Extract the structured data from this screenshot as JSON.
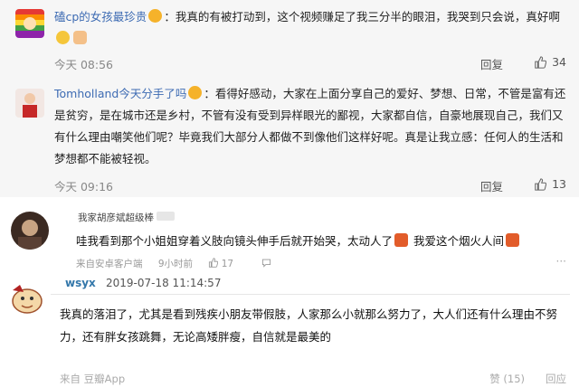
{
  "comments": [
    {
      "user": "磕cp的女孩最珍贵",
      "text": "：我真的有被打动到，这个视频赚足了我三分半的眼泪，我哭到只会说，真好啊",
      "time": "今天 08:56",
      "reply": "回复",
      "likes": "34"
    },
    {
      "user": "Tomholland今天分手了吗",
      "text": "：看得好感动，大家在上面分享自己的爱好、梦想、日常，不管是富有还是贫穷，是在城市还是乡村，不管有没有受到异样眼光的鄙视，大家都自信，自豪地展现自己，我们又有什么理由嘲笑他们呢？毕竟我们大部分人都做不到像他们这样好呢。真是让我立感：任何人的生活和梦想都不能被轻视。",
      "time": "今天 09:16",
      "reply": "回复",
      "likes": "13"
    }
  ],
  "db_comment": {
    "user": "我家胡彦斌超级棒",
    "text_a": "哇我看到那个小姐姐穿着义肢向镜头伸手后就开始哭，太动人了",
    "text_b": "我爱这个烟火人间",
    "source": "来自安卓客户端",
    "time": "9小时前",
    "likes": "17",
    "more": "···"
  },
  "douban": {
    "user": "wsyx",
    "time": "2019-07-18 11:14:57",
    "text": "我真的落泪了，尤其是看到残疾小朋友带假肢，人家那么小就那么努力了，大人们还有什么理由不努力，还有胖女孩跳舞，无论高矮胖瘦，自信就是最美的",
    "source": "来自 豆瓣App",
    "vote": "赞 (15)",
    "reply": "回应"
  }
}
